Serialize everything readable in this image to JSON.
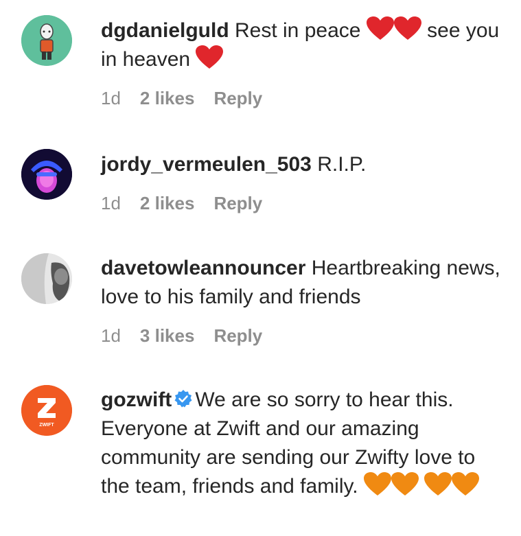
{
  "comments": [
    {
      "username": "dgdanielguld",
      "text_a": "Rest in peace",
      "text_b": "see you in heaven",
      "time": "1d",
      "likes": "2 likes",
      "reply": "Reply",
      "avatar_icon": "cartoon-person-icon",
      "heart_color": "#e0262c"
    },
    {
      "username": "jordy_vermeulen_503",
      "text_a": "R.I.P.",
      "time": "1d",
      "likes": "2 likes",
      "reply": "Reply",
      "avatar_icon": "neon-face-icon"
    },
    {
      "username": "davetowleannouncer",
      "text_a": "Heartbreaking news, love to his family and friends",
      "time": "1d",
      "likes": "3 likes",
      "reply": "Reply",
      "avatar_icon": "photo-avatar-icon"
    },
    {
      "username": "gozwift",
      "verified": true,
      "text_a": "We are so sorry to hear this. Everyone at Zwift and our amazing community are sending our Zwifty love to the team, friends and family.",
      "avatar_icon": "zwift-logo-icon",
      "avatar_logo_text": "ZWIFT",
      "heart_color": "#f08a12",
      "brand_color": "#f15a22"
    }
  ]
}
